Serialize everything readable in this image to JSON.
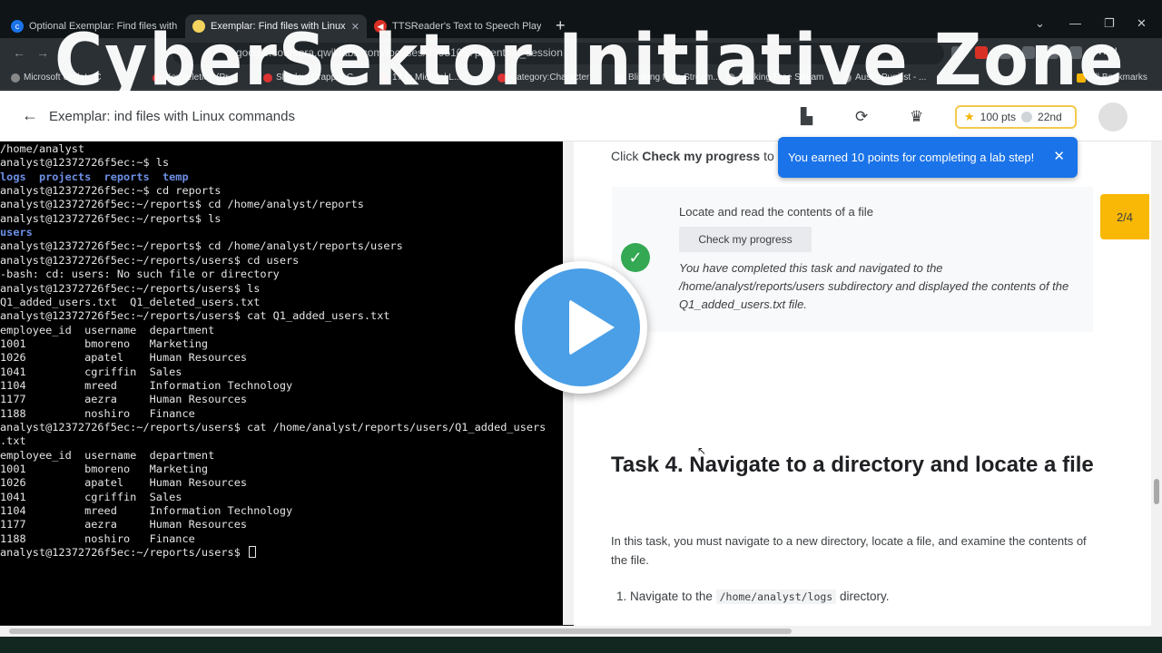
{
  "browser": {
    "tabs": [
      {
        "label": "Optional Exemplar: Find files with Linu",
        "active": false,
        "favicon_color": "#1a73e8"
      },
      {
        "label": "Exemplar: Find files with Linux co",
        "active": true,
        "favicon_color": "#f4d35e"
      },
      {
        "label": "TTSReader's Text to Speech Player",
        "active": false,
        "favicon_color": "#d93025"
      }
    ],
    "new_tab": "+",
    "window_controls": {
      "chevron": "⌄",
      "minimize": "—",
      "restore": "❐",
      "close": "✕"
    },
    "url": "google.coursera.qwiklabs.com/focuses/3395105?parent=lti_session",
    "vpn": "VPN",
    "bookmarks": [
      "Microsoft Update C",
      "KeySeletion (Pr...",
      "Shadow Crapper C",
      "17 to Michael L...",
      "Category:Character",
      "Blinking Free Stream...",
      "Blinking Free Stream",
      "Aust - Pugilist - ..."
    ],
    "all_bookmarks": "All Bookmarks"
  },
  "overlay": {
    "title": "CyberSektor Initiative Zone"
  },
  "lab": {
    "title": "Exemplar:   ind files with Linux commands",
    "points": "100 pts",
    "rank": "22nd"
  },
  "terminal": {
    "lines": [
      {
        "text": "/home/analyst",
        "style": "normal"
      },
      {
        "text": "analyst@12372726f5ec:~$ ls",
        "style": "normal"
      },
      {
        "text": "logs  projects  reports  temp",
        "style": "blue"
      },
      {
        "text": "analyst@12372726f5ec:~$ cd reports",
        "style": "normal"
      },
      {
        "text": "analyst@12372726f5ec:~/reports$ cd /home/analyst/reports",
        "style": "normal"
      },
      {
        "text": "analyst@12372726f5ec:~/reports$ ls",
        "style": "normal"
      },
      {
        "text": "users",
        "style": "blue"
      },
      {
        "text": "analyst@12372726f5ec:~/reports$ cd /home/analyst/reports/users",
        "style": "normal"
      },
      {
        "text": "analyst@12372726f5ec:~/reports/users$ cd users",
        "style": "normal"
      },
      {
        "text": "-bash: cd: users: No such file or directory",
        "style": "normal"
      },
      {
        "text": "analyst@12372726f5ec:~/reports/users$ ls",
        "style": "normal"
      },
      {
        "text": "Q1_added_users.txt  Q1_deleted_users.txt",
        "style": "normal"
      },
      {
        "text": "analyst@12372726f5ec:~/reports/users$ cat Q1_added_users.txt",
        "style": "normal"
      },
      {
        "text": "employee_id  username  department",
        "style": "normal"
      },
      {
        "text": "1001         bmoreno   Marketing",
        "style": "normal"
      },
      {
        "text": "1026         apatel    Human Resources",
        "style": "normal"
      },
      {
        "text": "1041         cgriffin  Sales",
        "style": "normal"
      },
      {
        "text": "1104         mreed     Information Technology",
        "style": "normal"
      },
      {
        "text": "1177         aezra     Human Resources",
        "style": "normal"
      },
      {
        "text": "1188         noshiro   Finance",
        "style": "normal"
      },
      {
        "text": "analyst@12372726f5ec:~/reports/users$ cat /home/analyst/reports/users/Q1_added_users",
        "style": "normal"
      },
      {
        "text": ".txt",
        "style": "normal"
      },
      {
        "text": "employee_id  username  department",
        "style": "normal"
      },
      {
        "text": "1001         bmoreno   Marketing",
        "style": "normal"
      },
      {
        "text": "1026         apatel    Human Resources",
        "style": "normal"
      },
      {
        "text": "1041         cgriffin  Sales",
        "style": "normal"
      },
      {
        "text": "1104         mreed     Information Technology",
        "style": "normal"
      },
      {
        "text": "1177         aezra     Human Resources",
        "style": "normal"
      },
      {
        "text": "1188         noshiro   Finance",
        "style": "normal"
      },
      {
        "text": "analyst@12372726f5ec:~/reports/users$ ",
        "style": "normal"
      }
    ]
  },
  "panel": {
    "click_prefix": "Click",
    "click_bold": "Check my progress",
    "click_suffix": "to ve",
    "card_title": "Locate and read the contents of a file",
    "check_button": "Check my progress",
    "card_message": "You have completed this task and navigated to the /home/analyst/reports/users subdirectory and displayed the contents of the Q1_added_users.txt file.",
    "task_heading": "Task 4. Navigate to a directory and locate a file",
    "task_paragraph": "In this task, you must navigate to a new directory, locate a file, and examine the contents of the file.",
    "step1_number": "1.",
    "step1_prefix": "Navigate to the",
    "step1_code": "/home/analyst/logs",
    "step1_suffix": "directory."
  },
  "toast": {
    "message": "You earned 10 points for completing a lab step!",
    "close": "✕"
  },
  "step_counter": "2/4",
  "colors": {
    "accent": "#1a73e8",
    "success": "#34a853",
    "badge": "#f9b806",
    "play": "#4a9fe6"
  }
}
